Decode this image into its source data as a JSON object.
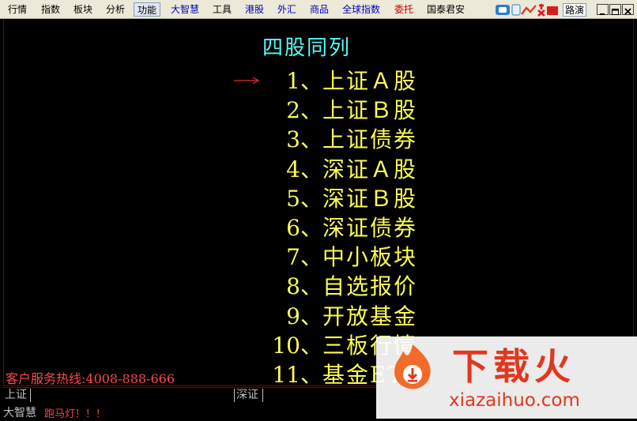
{
  "menubar": {
    "items": [
      {
        "label": "行情",
        "style": "normal"
      },
      {
        "label": "指数",
        "style": "normal"
      },
      {
        "label": "板块",
        "style": "normal"
      },
      {
        "label": "分析",
        "style": "normal"
      },
      {
        "label": "功能",
        "style": "active"
      },
      {
        "label": "大智慧",
        "style": "blue"
      },
      {
        "label": "工具",
        "style": "normal"
      },
      {
        "label": "港股",
        "style": "blue"
      },
      {
        "label": "外汇",
        "style": "blue"
      },
      {
        "label": "商品",
        "style": "blue"
      },
      {
        "label": "全球指数",
        "style": "blue"
      },
      {
        "label": "委托",
        "style": "red"
      },
      {
        "label": "国泰君安",
        "style": "normal"
      }
    ],
    "route_label": "路演",
    "logo_icon": "dazhihui-logo"
  },
  "main": {
    "title": "四股同列",
    "items": [
      {
        "num": "1、",
        "label": "上证Ａ股"
      },
      {
        "num": "2、",
        "label": "上证Ｂ股"
      },
      {
        "num": "3、",
        "label": "上证债券"
      },
      {
        "num": "4、",
        "label": "深证Ａ股"
      },
      {
        "num": "5、",
        "label": "深证Ｂ股"
      },
      {
        "num": "6、",
        "label": "深证债券"
      },
      {
        "num": "7、",
        "label": "中小板块"
      },
      {
        "num": "8、",
        "label": "自选报价"
      },
      {
        "num": "9、",
        "label": "开放基金"
      },
      {
        "num": "10、",
        "label": "三板行情"
      },
      {
        "num": "11、",
        "label": "基金ETF"
      }
    ],
    "hotline": "客户服务热线:4008-888-666",
    "colors": {
      "title": "#54fcfc",
      "items": "#fcfc54",
      "hotline": "#ff4848"
    }
  },
  "status": {
    "cells": [
      "上证",
      "深证"
    ]
  },
  "ticker": {
    "brand": "大智慧",
    "text": "跑马灯！！！"
  },
  "watermark": {
    "title": "下载火",
    "domain": "xiazaihuo.com",
    "color": "#e2371f"
  }
}
